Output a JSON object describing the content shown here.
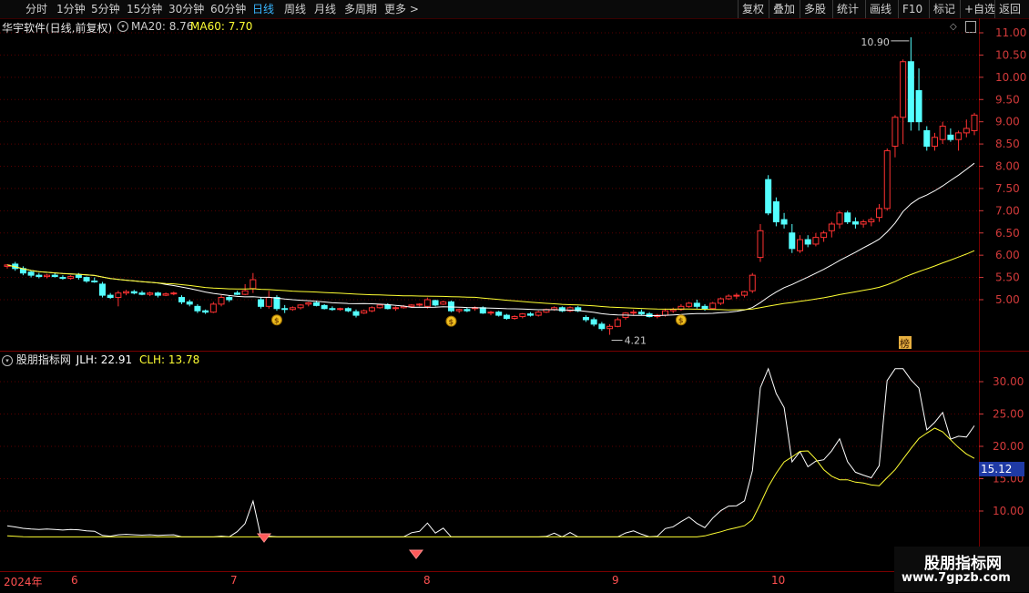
{
  "toolbar": {
    "left": [
      "分时",
      "1分钟",
      "5分钟",
      "15分钟",
      "30分钟",
      "60分钟",
      "日线",
      "周线",
      "月线",
      "多周期",
      "更多"
    ],
    "active": "日线",
    "right": [
      "复权",
      "叠加",
      "多股",
      "统计",
      "画线",
      "F10",
      "标记",
      "+自选",
      "返回"
    ]
  },
  "stock": {
    "title": "华宇软件(日线,前复权)"
  },
  "ma": {
    "ma20": "MA20: 8.76",
    "ma60": "MA60: 7.70",
    "ma20_color": "#ffffff",
    "ma60_color": "#ffff33"
  },
  "annotations": {
    "high": "10.90",
    "low": "4.21",
    "bang": "榜"
  },
  "price_axis": [
    "11.00",
    "10.50",
    "10.00",
    "9.50",
    "9.00",
    "8.50",
    "8.00",
    "7.50",
    "7.00",
    "6.50",
    "6.00",
    "5.50",
    "5.00"
  ],
  "indicator": {
    "title": "股朋指标网",
    "jlh": "JLH: 22.91",
    "clh": "CLH: 13.78",
    "current": "15.12",
    "jlh_color": "#ffffff",
    "clh_color": "#ffff33"
  },
  "indicator_axis": [
    "30.00",
    "25.00",
    "20.00",
    "15.00",
    "10.00"
  ],
  "dates": [
    "2024年",
    "6",
    "7",
    "8",
    "9",
    "10"
  ],
  "watermark": {
    "line1": "股朋指标网",
    "line2": "www.7gpzb.com"
  },
  "colors": {
    "up": "#ff3232",
    "down": "#54ffff",
    "grid": "#7a0000"
  },
  "chart_data": {
    "type": "candlestick",
    "candles": [
      [
        5.75,
        5.8,
        5.7,
        5.78
      ],
      [
        5.8,
        5.85,
        5.65,
        5.7
      ],
      [
        5.7,
        5.75,
        5.55,
        5.6
      ],
      [
        5.62,
        5.65,
        5.5,
        5.55
      ],
      [
        5.55,
        5.6,
        5.48,
        5.52
      ],
      [
        5.52,
        5.58,
        5.48,
        5.55
      ],
      [
        5.55,
        5.6,
        5.5,
        5.52
      ],
      [
        5.5,
        5.55,
        5.45,
        5.48
      ],
      [
        5.48,
        5.55,
        5.45,
        5.52
      ],
      [
        5.55,
        5.6,
        5.45,
        5.5
      ],
      [
        5.5,
        5.52,
        5.38,
        5.42
      ],
      [
        5.42,
        5.5,
        5.38,
        5.4
      ],
      [
        5.35,
        5.4,
        5.05,
        5.1
      ],
      [
        5.1,
        5.15,
        5.02,
        5.05
      ],
      [
        5.05,
        5.2,
        4.85,
        5.15
      ],
      [
        5.15,
        5.22,
        5.1,
        5.18
      ],
      [
        5.18,
        5.22,
        5.12,
        5.15
      ],
      [
        5.15,
        5.2,
        5.1,
        5.12
      ],
      [
        5.12,
        5.18,
        5.08,
        5.15
      ],
      [
        5.15,
        5.18,
        5.05,
        5.1
      ],
      [
        5.1,
        5.16,
        5.08,
        5.13
      ],
      [
        5.13,
        5.18,
        5.1,
        5.15
      ],
      [
        5.05,
        5.1,
        4.9,
        4.95
      ],
      [
        4.95,
        5.0,
        4.85,
        4.9
      ],
      [
        4.85,
        4.9,
        4.7,
        4.75
      ],
      [
        4.75,
        4.78,
        4.68,
        4.72
      ],
      [
        4.72,
        4.95,
        4.7,
        4.9
      ],
      [
        4.9,
        5.1,
        4.85,
        5.05
      ],
      [
        5.05,
        5.1,
        4.95,
        5.0
      ],
      [
        5.15,
        5.2,
        5.1,
        5.12
      ],
      [
        5.12,
        5.35,
        5.1,
        5.2
      ],
      [
        5.25,
        5.6,
        5.15,
        5.45
      ],
      [
        5.0,
        5.05,
        4.8,
        4.85
      ],
      [
        4.85,
        5.2,
        4.8,
        5.05
      ],
      [
        5.05,
        5.1,
        4.75,
        4.8
      ],
      [
        4.8,
        4.88,
        4.7,
        4.78
      ],
      [
        4.78,
        4.85,
        4.75,
        4.82
      ],
      [
        4.82,
        4.9,
        4.78,
        4.88
      ],
      [
        4.9,
        4.95,
        4.85,
        4.93
      ],
      [
        4.93,
        4.98,
        4.85,
        4.87
      ],
      [
        4.87,
        4.9,
        4.78,
        4.8
      ],
      [
        4.8,
        4.85,
        4.75,
        4.78
      ],
      [
        4.78,
        4.82,
        4.75,
        4.8
      ],
      [
        4.8,
        4.83,
        4.72,
        4.75
      ],
      [
        4.73,
        4.78,
        4.6,
        4.65
      ],
      [
        4.7,
        4.78,
        4.68,
        4.75
      ],
      [
        4.75,
        4.85,
        4.72,
        4.82
      ],
      [
        4.82,
        4.9,
        4.8,
        4.88
      ],
      [
        4.88,
        4.92,
        4.78,
        4.8
      ],
      [
        4.8,
        4.85,
        4.75,
        4.82
      ],
      [
        4.82,
        4.88,
        4.8,
        4.85
      ],
      [
        4.85,
        4.9,
        4.82,
        4.88
      ],
      [
        4.88,
        4.92,
        4.85,
        4.9
      ],
      [
        4.85,
        5.05,
        4.8,
        5.0
      ],
      [
        4.98,
        5.0,
        4.85,
        4.88
      ],
      [
        4.9,
        4.98,
        4.88,
        4.95
      ],
      [
        4.95,
        4.98,
        4.72,
        4.75
      ],
      [
        4.75,
        4.8,
        4.7,
        4.78
      ],
      [
        4.78,
        4.82,
        4.72,
        4.75
      ],
      [
        4.8,
        4.85,
        4.75,
        4.82
      ],
      [
        4.82,
        4.85,
        4.68,
        4.7
      ],
      [
        4.7,
        4.75,
        4.65,
        4.72
      ],
      [
        4.72,
        4.75,
        4.62,
        4.65
      ],
      [
        4.65,
        4.68,
        4.55,
        4.58
      ],
      [
        4.58,
        4.65,
        4.55,
        4.62
      ],
      [
        4.62,
        4.7,
        4.58,
        4.68
      ],
      [
        4.68,
        4.72,
        4.62,
        4.65
      ],
      [
        4.65,
        4.75,
        4.62,
        4.72
      ],
      [
        4.72,
        4.8,
        4.7,
        4.78
      ],
      [
        4.78,
        4.85,
        4.75,
        4.82
      ],
      [
        4.82,
        4.85,
        4.72,
        4.75
      ],
      [
        4.75,
        4.85,
        4.72,
        4.82
      ],
      [
        4.82,
        4.86,
        4.72,
        4.75
      ],
      [
        4.6,
        4.65,
        4.5,
        4.55
      ],
      [
        4.55,
        4.6,
        4.4,
        4.45
      ],
      [
        4.45,
        4.5,
        4.3,
        4.35
      ],
      [
        4.35,
        4.45,
        4.21,
        4.4
      ],
      [
        4.4,
        4.6,
        4.38,
        4.55
      ],
      [
        4.6,
        4.72,
        4.55,
        4.7
      ],
      [
        4.7,
        4.78,
        4.65,
        4.72
      ],
      [
        4.72,
        4.78,
        4.65,
        4.68
      ],
      [
        4.68,
        4.72,
        4.6,
        4.62
      ],
      [
        4.62,
        4.68,
        4.58,
        4.65
      ],
      [
        4.65,
        4.8,
        4.62,
        4.75
      ],
      [
        4.75,
        4.82,
        4.7,
        4.78
      ],
      [
        4.78,
        4.9,
        4.75,
        4.85
      ],
      [
        4.85,
        4.95,
        4.82,
        4.92
      ],
      [
        4.92,
        5.0,
        4.8,
        4.85
      ],
      [
        4.85,
        4.9,
        4.75,
        4.8
      ],
      [
        4.8,
        4.95,
        4.78,
        4.92
      ],
      [
        4.92,
        5.05,
        4.88,
        5.02
      ],
      [
        5.02,
        5.12,
        5.0,
        5.08
      ],
      [
        5.08,
        5.15,
        5.02,
        5.1
      ],
      [
        5.1,
        5.2,
        5.05,
        5.18
      ],
      [
        5.2,
        5.6,
        5.15,
        5.55
      ],
      [
        5.95,
        6.7,
        5.85,
        6.55
      ],
      [
        7.7,
        7.8,
        6.9,
        6.95
      ],
      [
        7.2,
        7.3,
        6.65,
        6.75
      ],
      [
        6.8,
        6.95,
        6.6,
        6.7
      ],
      [
        6.5,
        6.7,
        6.05,
        6.15
      ],
      [
        6.1,
        6.45,
        6.05,
        6.35
      ],
      [
        6.35,
        6.45,
        6.18,
        6.25
      ],
      [
        6.25,
        6.5,
        6.2,
        6.4
      ],
      [
        6.4,
        6.55,
        6.3,
        6.5
      ],
      [
        6.55,
        6.75,
        6.4,
        6.7
      ],
      [
        6.7,
        7.0,
        6.6,
        6.95
      ],
      [
        6.95,
        7.0,
        6.7,
        6.75
      ],
      [
        6.75,
        6.85,
        6.6,
        6.7
      ],
      [
        6.7,
        6.8,
        6.62,
        6.75
      ],
      [
        6.75,
        6.85,
        6.65,
        6.8
      ],
      [
        6.85,
        7.15,
        6.75,
        7.05
      ],
      [
        7.05,
        8.4,
        7.0,
        8.35
      ],
      [
        8.45,
        9.15,
        8.2,
        9.1
      ],
      [
        9.1,
        10.4,
        8.5,
        10.35
      ],
      [
        10.35,
        10.9,
        8.8,
        9.0
      ],
      [
        9.7,
        10.2,
        8.8,
        9.0
      ],
      [
        8.8,
        8.9,
        8.35,
        8.45
      ],
      [
        8.45,
        8.75,
        8.35,
        8.65
      ],
      [
        8.6,
        9.0,
        8.5,
        8.9
      ],
      [
        8.7,
        8.85,
        8.55,
        8.6
      ],
      [
        8.6,
        8.8,
        8.35,
        8.75
      ],
      [
        8.75,
        9.05,
        8.65,
        8.85
      ],
      [
        8.8,
        9.2,
        8.7,
        9.15
      ]
    ],
    "y_range": [
      4.21,
      10.9
    ],
    "indicator_range": [
      5,
      33
    ]
  }
}
